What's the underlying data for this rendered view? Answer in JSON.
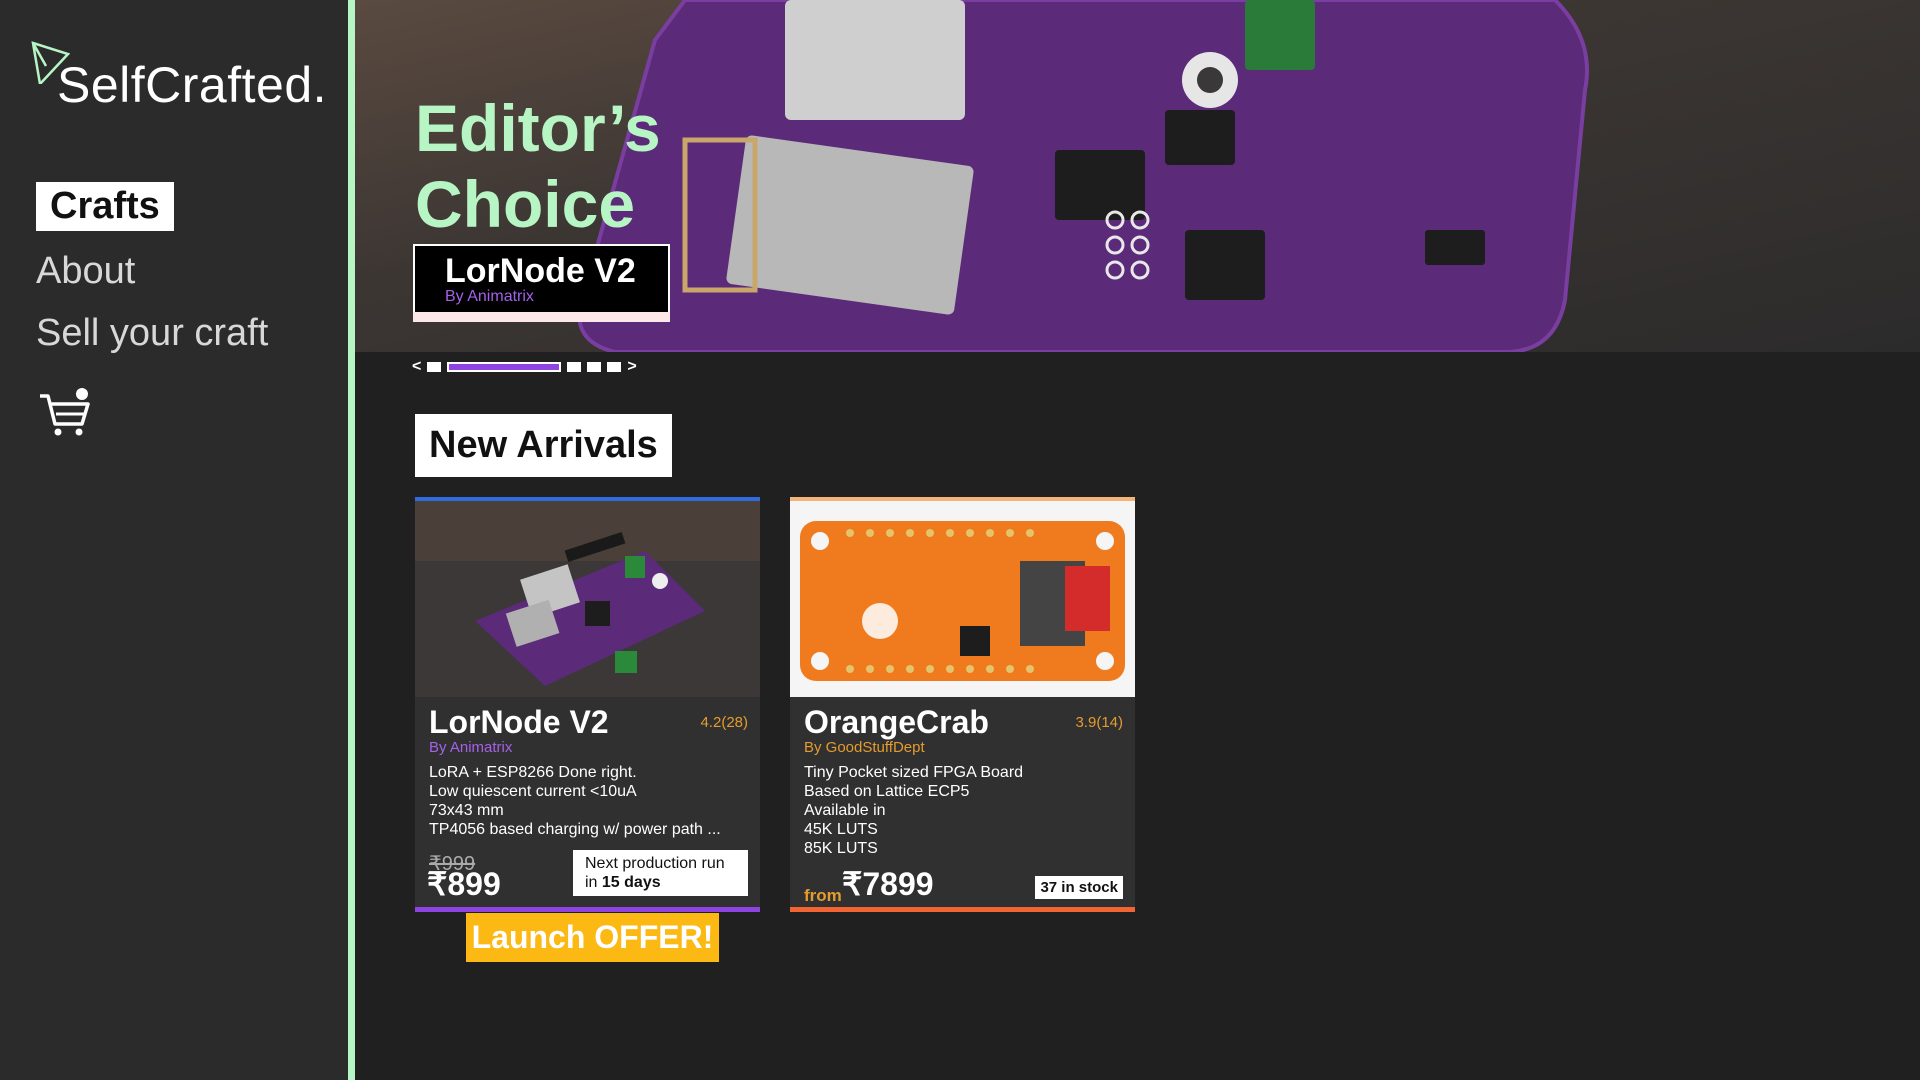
{
  "brand": {
    "name": "SelfCrafted.",
    "accent": "#b8f5c4"
  },
  "sidebar": {
    "items": [
      {
        "label": "Crafts",
        "active": true
      },
      {
        "label": "About",
        "active": false
      },
      {
        "label": "Sell your craft",
        "active": false
      }
    ],
    "cart_icon": "cart-icon"
  },
  "hero": {
    "title_line1": "Editor’s",
    "title_line2": "Choice",
    "featured": {
      "name": "LorNode V2",
      "by": "By Animatrix"
    },
    "carousel": {
      "prev": "<",
      "next": ">",
      "slides": 5,
      "active_index": 1
    }
  },
  "new_arrivals": {
    "title": "New Arrivals",
    "products": [
      {
        "name": "LorNode V2",
        "rating": "4.2(28)",
        "by": "By Animatrix",
        "desc": [
          "LoRA + ESP8266 Done right.",
          "Low quiescent current <10uA",
          "73x43 mm",
          "TP4056 based charging w/ power path ..."
        ],
        "old_price": "₹999",
        "price": "₹899",
        "badge_line1": "Next production run",
        "badge_line2_prefix": "in ",
        "badge_line2_bold": "15 days",
        "offer": "Launch OFFER!"
      },
      {
        "name": "OrangeCrab",
        "rating": "3.9(14)",
        "by": "By GoodStuffDept",
        "desc": [
          "Tiny Pocket sized FPGA Board",
          "Based on Lattice ECP5",
          "Available in",
          "45K LUTS",
          "85K LUTS"
        ],
        "price_from": "from",
        "price": "₹7899",
        "badge": "37 in stock"
      }
    ]
  }
}
